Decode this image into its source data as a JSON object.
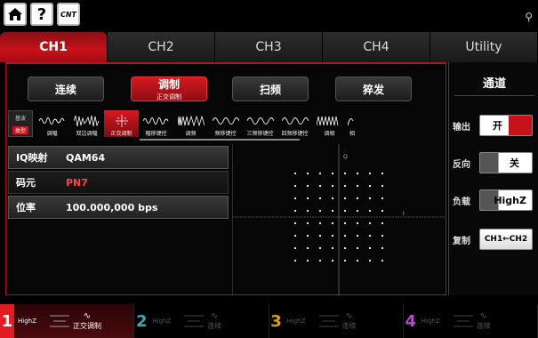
{
  "topbar": {
    "cnt_label": "CNT"
  },
  "tabs": [
    {
      "label": "CH1",
      "active": true
    },
    {
      "label": "CH2",
      "active": false
    },
    {
      "label": "CH3",
      "active": false
    },
    {
      "label": "CH4",
      "active": false
    },
    {
      "label": "Utility",
      "active": false
    }
  ],
  "modes": [
    {
      "label": "连续",
      "sub": ""
    },
    {
      "label": "调制",
      "sub": "正交调制",
      "active": true
    },
    {
      "label": "扫频",
      "sub": ""
    },
    {
      "label": "猝发",
      "sub": ""
    }
  ],
  "type_box": {
    "top": "基波",
    "bottom": "类型"
  },
  "mod_types": [
    {
      "label": "调幅"
    },
    {
      "label": "双边调幅"
    },
    {
      "label": "正交调制",
      "active": true
    },
    {
      "label": "幅移键控"
    },
    {
      "label": "调频"
    },
    {
      "label": "频移键控"
    },
    {
      "label": "三频移键控"
    },
    {
      "label": "四频移键控"
    },
    {
      "label": "调相"
    },
    {
      "label": "相"
    }
  ],
  "params": [
    {
      "label": "IQ映射",
      "value": "QAM64"
    },
    {
      "label": "码元",
      "value": "PN7",
      "active": true
    },
    {
      "label": "位率",
      "value": "100.000,000 bps"
    }
  ],
  "constellation": {
    "i_label": "I",
    "q_label": "Q"
  },
  "side": {
    "title": "通道",
    "output": {
      "label": "输出",
      "value": "开"
    },
    "invert": {
      "label": "反向",
      "value": "关"
    },
    "load": {
      "label": "负载",
      "value": "HighZ"
    },
    "copy": {
      "label": "复制",
      "value": "CH1←CH2"
    }
  },
  "bottom": [
    {
      "num": "1",
      "load": "HighZ",
      "mode": "正交调制"
    },
    {
      "num": "2",
      "load": "HighZ",
      "mode": "连续"
    },
    {
      "num": "3",
      "load": "HighZ",
      "mode": "连续"
    },
    {
      "num": "4",
      "load": "HighZ",
      "mode": "连续"
    }
  ],
  "colors": {
    "accent": "#c8121a",
    "ch2": "#4aa3b0",
    "ch3": "#d9a000",
    "ch4": "#b050c0"
  }
}
